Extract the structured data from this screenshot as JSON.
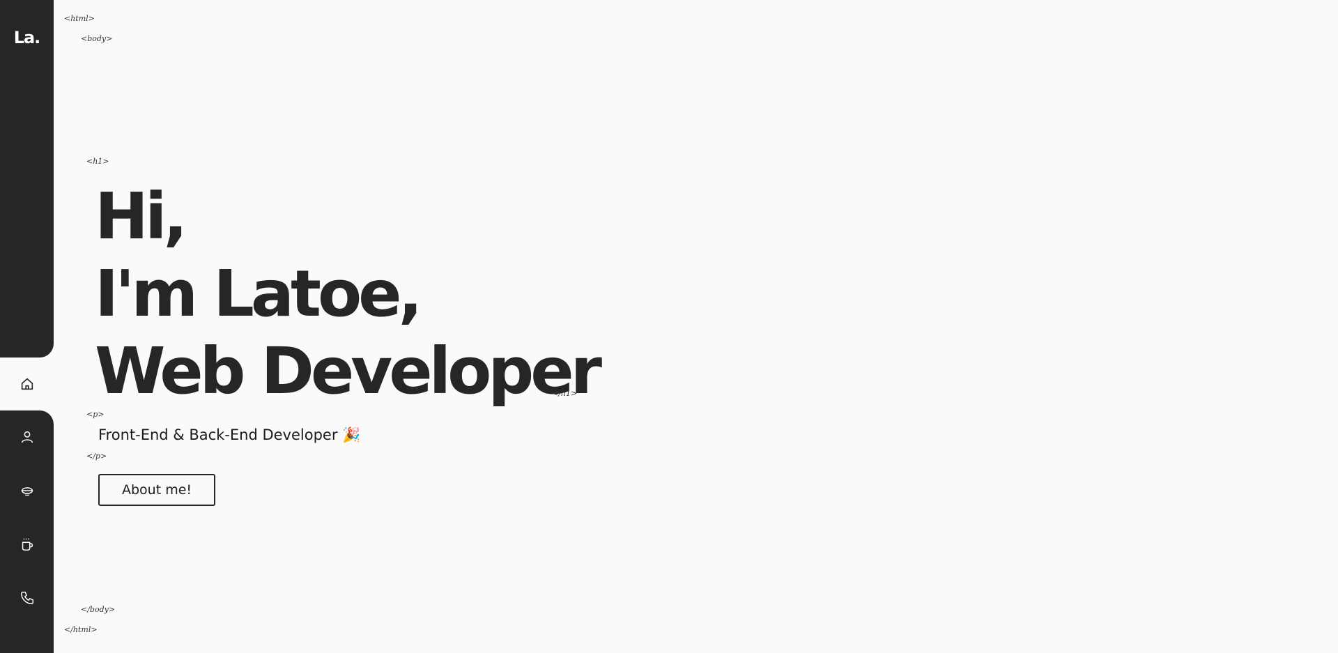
{
  "sidebar": {
    "logo": "La.",
    "items": [
      {
        "icon": "home-icon"
      },
      {
        "icon": "user-icon"
      },
      {
        "icon": "bowl-icon"
      },
      {
        "icon": "coffee-cup-icon"
      },
      {
        "icon": "phone-icon"
      }
    ]
  },
  "tags": {
    "html_open": "<html>",
    "body_open": "<body>",
    "h1_open": "<h1>",
    "h1_close": "</h1>",
    "p_open": "<p>",
    "p_close": "</p>",
    "body_close": "</body>",
    "html_close": "</html>"
  },
  "hero": {
    "line1": "Hi,",
    "line2": "I'm Latoe,",
    "line3": "Web Developer"
  },
  "subtitle": "Front-End & Back-End Developer 🎉",
  "about_button": "About me!",
  "colors": {
    "sidebar_bg": "#262626",
    "page_bg": "#fafafa",
    "text": "#262626"
  }
}
